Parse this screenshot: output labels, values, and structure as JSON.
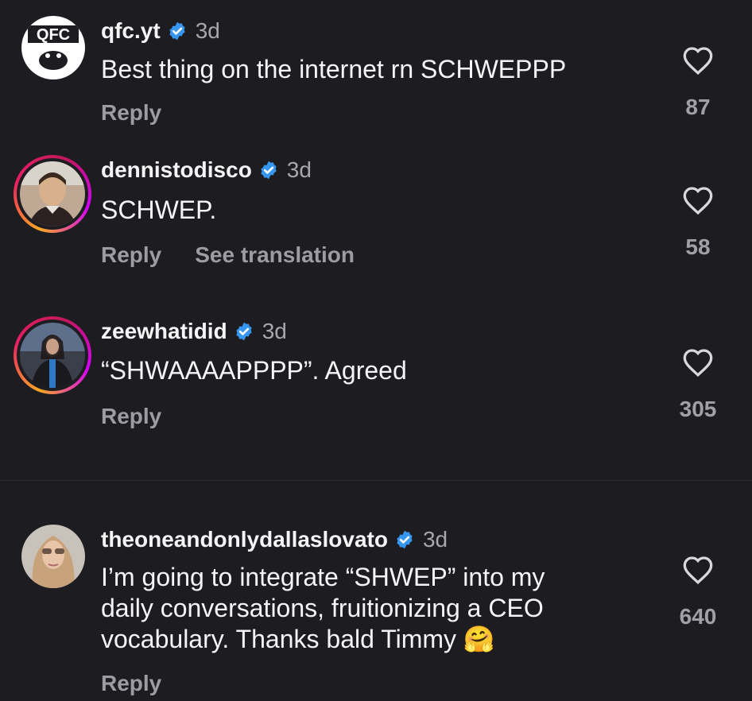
{
  "comments": [
    {
      "username": "qfc.yt",
      "time": "3d",
      "text": "Best thing on the internet rn SCHWEPPP",
      "reply": "Reply",
      "likes": "87",
      "avatar_logo": "QFC"
    },
    {
      "username": "dennistodisco",
      "time": "3d",
      "text": "SCHWEP.",
      "reply": "Reply",
      "translation": "See translation",
      "likes": "58"
    },
    {
      "username": "zeewhatidid",
      "time": "3d",
      "text": "“SHWAAAAPPPP”. Agreed",
      "reply": "Reply",
      "likes": "305"
    },
    {
      "username": "theoneandonlydallaslovato",
      "time": "3d",
      "text_lines": [
        "I’m going to integrate “SHWEP” into my",
        "daily conversations, fruitionizing a CEO",
        "vocabulary. Thanks bald Timmy 🤗"
      ],
      "reply": "Reply",
      "likes": "640"
    }
  ],
  "colors": {
    "background": "#1c1c21",
    "verified": "#3797f0",
    "secondary_text": "#9c9ca3"
  }
}
